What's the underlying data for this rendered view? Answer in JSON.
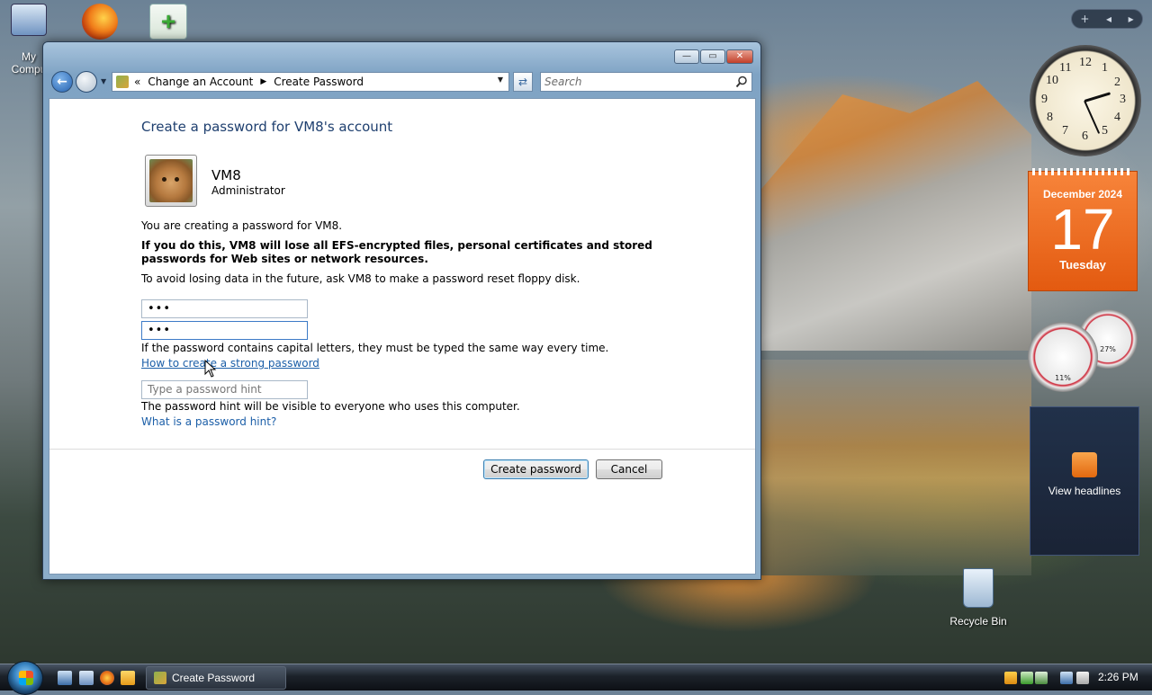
{
  "desktop": {
    "icons": [
      {
        "label": "My Compu",
        "icon": "computer-icon"
      },
      {
        "label": "",
        "icon": "firefox-icon"
      },
      {
        "label": "",
        "icon": "program-shortcut-icon"
      }
    ],
    "recycle_bin_label": "Recycle Bin"
  },
  "window": {
    "address": {
      "overflow": "«",
      "crumbs": [
        "Change an Account",
        "Create Password"
      ]
    },
    "search_placeholder": "Search",
    "heading": "Create a password for VM8's account",
    "user": {
      "name": "VM8",
      "role": "Administrator"
    },
    "intro": "You are creating a password for VM8.",
    "warning": "If you do this, VM8 will lose all EFS-encrypted files, personal certificates and stored passwords for Web sites or network resources.",
    "advice": "To avoid losing data in the future, ask VM8 to make a password reset floppy disk.",
    "password_value": "•••",
    "confirm_value": "•••",
    "caps_note": "If the password contains capital letters, they must be typed the same way every time.",
    "strong_link": "How to create a strong password",
    "hint_placeholder": "Type a password hint",
    "hint_note": "The password hint will be visible to everyone who uses this computer.",
    "hint_link": "What is a password hint?",
    "create_button": "Create password",
    "cancel_button": "Cancel",
    "controls": {
      "minimize": "—",
      "maximize": "▭",
      "close": "✕"
    }
  },
  "gadgets": {
    "clock_numbers": [
      "12",
      "1",
      "2",
      "3",
      "4",
      "5",
      "6",
      "7",
      "8",
      "9",
      "10",
      "11"
    ],
    "calendar": {
      "month": "December 2024",
      "day": "17",
      "weekday": "Tuesday"
    },
    "cpu_percent": "11%",
    "mem_percent": "27%",
    "feed_label": "View headlines",
    "sidebar_controls": [
      "+",
      "◂",
      "▸"
    ]
  },
  "taskbar": {
    "task_label": "Create Password",
    "time": "2:26 PM"
  }
}
